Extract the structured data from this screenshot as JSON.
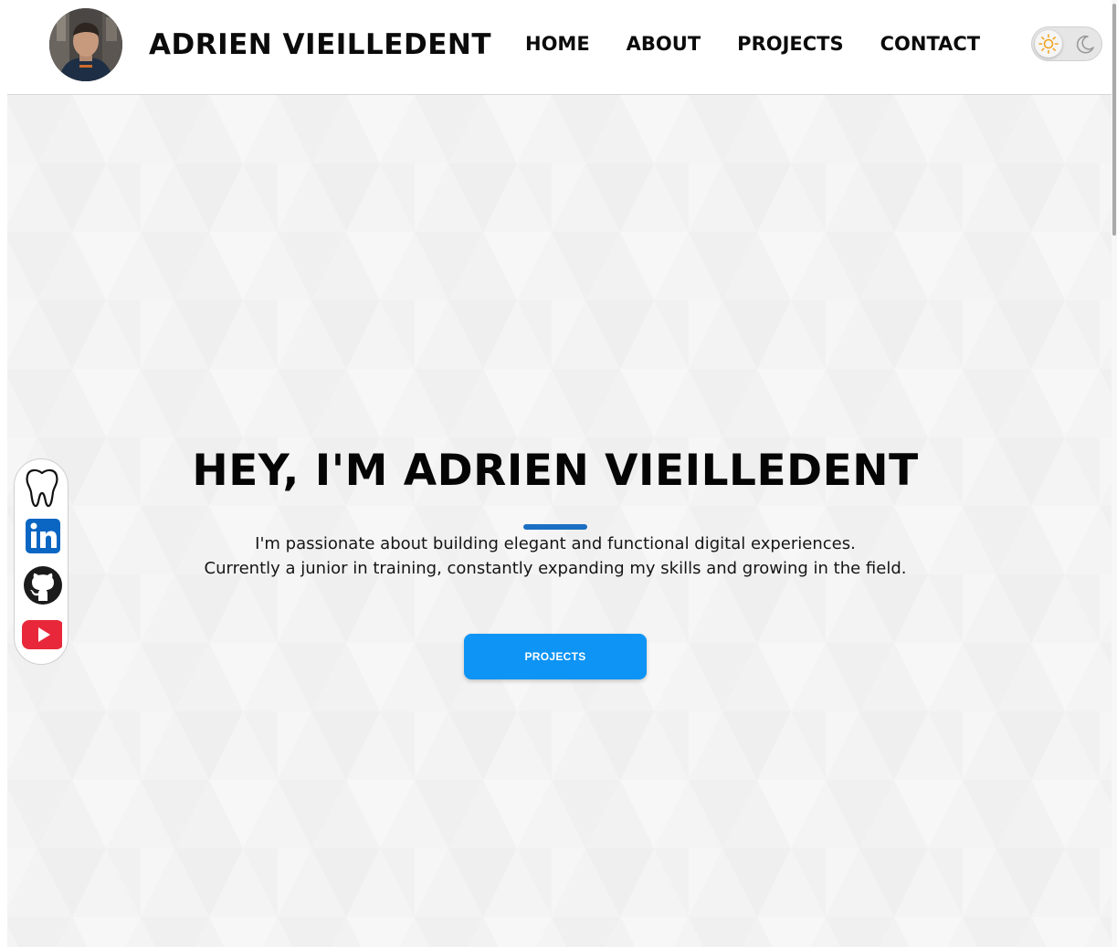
{
  "header": {
    "name": "ADRIEN VIEILLEDENT",
    "nav": [
      "HOME",
      "ABOUT",
      "PROJECTS",
      "CONTACT"
    ]
  },
  "theme_toggle": {
    "icons": [
      "sun-icon",
      "moon-icon"
    ],
    "active": "light"
  },
  "hero": {
    "title": "HEY, I'M ADRIEN VIEILLEDENT",
    "line1": "I'm passionate about building elegant and functional digital experiences.",
    "line2": "Currently a junior in training, constantly expanding my skills and growing in the field.",
    "button_label": "PROJECTS"
  },
  "social": {
    "items": [
      "tooth-icon",
      "linkedin-icon",
      "github-icon",
      "youtube-icon"
    ]
  },
  "colors": {
    "accent": "#0d94f4",
    "divider": "#1b6fc2",
    "background": "#f4f4f4",
    "linkedin": "#0a66c2",
    "youtube": "#e8283a"
  }
}
